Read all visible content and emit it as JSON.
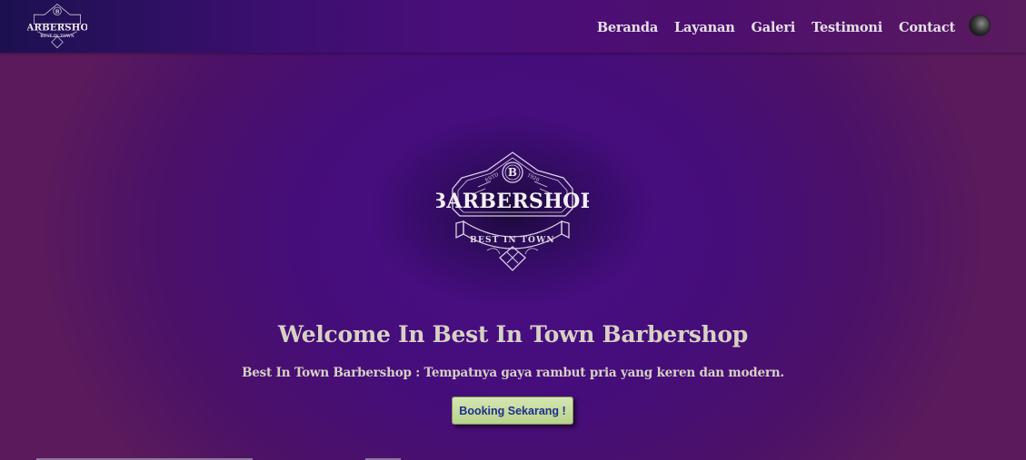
{
  "nav": {
    "logo": {
      "brand": "BARBERSHOP",
      "tagline": "BEST IN TOWN"
    },
    "links": [
      "Beranda",
      "Layanan",
      "Galeri",
      "Testimoni",
      "Contact"
    ]
  },
  "hero": {
    "logo": {
      "brand": "BARBERSHOP",
      "tagline": "BEST IN TOWN",
      "estd": "ESTD",
      "year": "1920",
      "initial": "B"
    },
    "title": "Welcome In Best In Town Barbershop",
    "subtitle": "Best In Town Barbershop : Tempatnya gaya rambut pria yang keren dan modern.",
    "button_label": "Booking Sekarang !"
  },
  "colors": {
    "accent_text": "#d7d1c4",
    "background_purple": "#4a0e86",
    "button_green": "#c4dc9e",
    "button_text": "#1b2f8c"
  }
}
